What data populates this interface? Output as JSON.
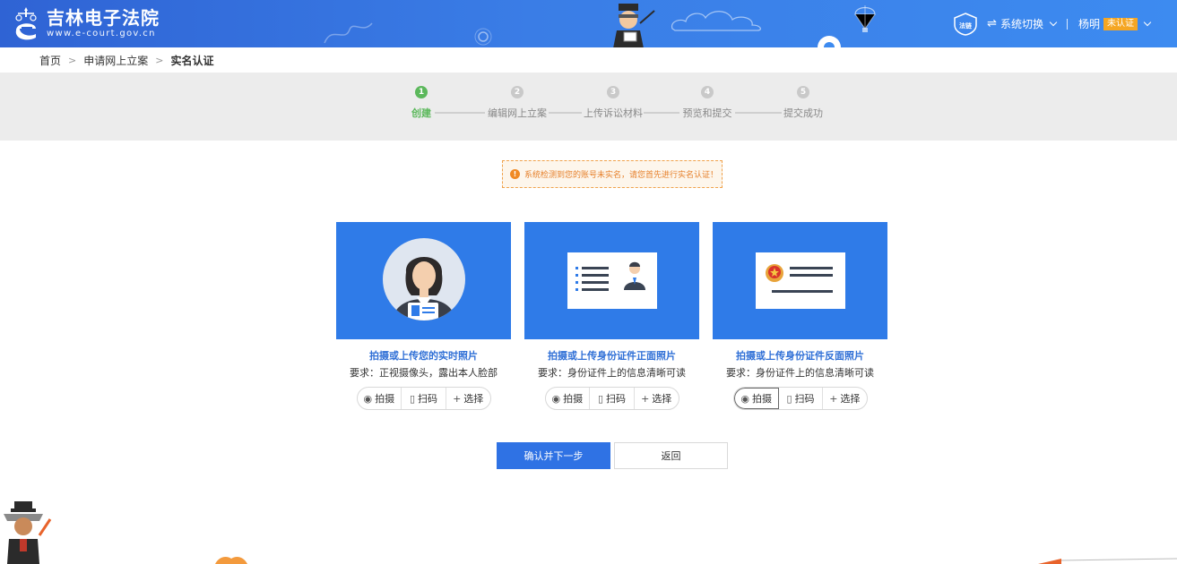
{
  "header": {
    "logo_title": "吉林电子法院",
    "logo_sub": "www.e-court.gov.cn",
    "badge_text": "法链",
    "system_switch": "系统切换",
    "user_name": "杨明",
    "verify_status": "未认证"
  },
  "breadcrumb": {
    "items": [
      "首页",
      "申请网上立案",
      "实名认证"
    ]
  },
  "steps": [
    {
      "num": "1",
      "label": "创建"
    },
    {
      "num": "2",
      "label": "编辑网上立案"
    },
    {
      "num": "3",
      "label": "上传诉讼材料"
    },
    {
      "num": "4",
      "label": "预览和提交"
    },
    {
      "num": "5",
      "label": "提交成功"
    }
  ],
  "notice": {
    "text": "系统检测到您的账号未实名，请您首先进行实名认证！"
  },
  "cards": [
    {
      "title": "拍摄或上传您的实时照片",
      "requirement": "要求：正视摄像头，露出本人脸部"
    },
    {
      "title": "拍摄或上传身份证件正面照片",
      "requirement": "要求：身份证件上的信息清晰可读"
    },
    {
      "title": "拍摄或上传身份证件反面照片",
      "requirement": "要求：身份证件上的信息清晰可读"
    }
  ],
  "card_actions": {
    "shoot": "拍摄",
    "scan": "扫码",
    "choose": "选择"
  },
  "buttons": {
    "confirm": "确认并下一步",
    "back": "返回"
  },
  "colors": {
    "header_blue": "#3a7de6",
    "card_blue": "#2f7be8",
    "active_green": "#5cb85c",
    "warning_orange": "#e6802b",
    "verify_tag": "#f5a623"
  }
}
